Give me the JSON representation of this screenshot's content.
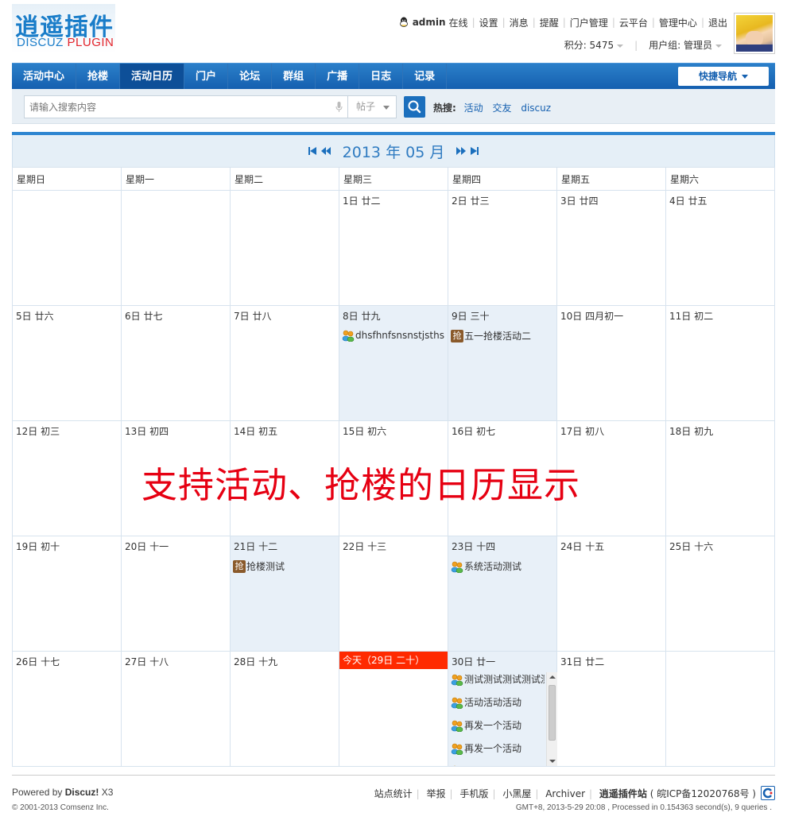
{
  "logo": {
    "cn": "逍遥插件",
    "en_part1": "DISCUZ",
    "en_part2": " PLUGIN"
  },
  "user": {
    "name": "admin",
    "status": "在线",
    "links": [
      "设置",
      "消息",
      "提醒",
      "门户管理",
      "云平台",
      "管理中心",
      "退出"
    ],
    "credits": "积分: 5475",
    "group": "用户组: 管理员"
  },
  "nav": {
    "items": [
      "活动中心",
      "抢楼",
      "活动日历",
      "门户",
      "论坛",
      "群组",
      "广播",
      "日志",
      "记录"
    ],
    "active_index": 2,
    "quick_nav": "快捷导航"
  },
  "search": {
    "placeholder": "请输入搜索内容",
    "type": "帖子",
    "hot_label": "热搜:",
    "hot_terms": [
      "活动",
      "交友",
      "discuz"
    ]
  },
  "calendar": {
    "title": "2013 年 05 月",
    "weekdays": [
      "星期日",
      "星期一",
      "星期二",
      "星期三",
      "星期四",
      "星期五",
      "星期六"
    ],
    "weeks": [
      [
        {
          "label": ""
        },
        {
          "label": ""
        },
        {
          "label": ""
        },
        {
          "label": "1日 廿二"
        },
        {
          "label": "2日 廿三"
        },
        {
          "label": "3日 廿四"
        },
        {
          "label": "4日 廿五"
        }
      ],
      [
        {
          "label": "5日 廿六"
        },
        {
          "label": "6日 廿七"
        },
        {
          "label": "7日 廿八"
        },
        {
          "label": "8日 廿九",
          "events": [
            {
              "icon": "activity",
              "text": "dhsfhnfsnsnstjsthsh"
            }
          ]
        },
        {
          "label": "9日 三十",
          "events": [
            {
              "icon": "qianglou",
              "text": "五一抢楼活动二"
            }
          ]
        },
        {
          "label": "10日 四月初一"
        },
        {
          "label": "11日 初二"
        }
      ],
      [
        {
          "label": "12日 初三"
        },
        {
          "label": "13日 初四"
        },
        {
          "label": "14日 初五"
        },
        {
          "label": "15日 初六"
        },
        {
          "label": "16日 初七"
        },
        {
          "label": "17日 初八"
        },
        {
          "label": "18日 初九"
        }
      ],
      [
        {
          "label": "19日 初十"
        },
        {
          "label": "20日 十一"
        },
        {
          "label": "21日 十二",
          "events": [
            {
              "icon": "qianglou",
              "text": "抢楼测试"
            }
          ]
        },
        {
          "label": "22日 十三"
        },
        {
          "label": "23日 十四",
          "events": [
            {
              "icon": "activity",
              "text": "系统活动测试"
            }
          ]
        },
        {
          "label": "24日 十五"
        },
        {
          "label": "25日 十六"
        }
      ],
      [
        {
          "label": "26日 十七"
        },
        {
          "label": "27日 十八"
        },
        {
          "label": "28日 十九"
        },
        {
          "label": "今天（29日 二十）",
          "today": true
        },
        {
          "label": "30日 廿一",
          "scroll": true,
          "events": [
            {
              "icon": "activity",
              "text": "测试测试测试测试测试"
            },
            {
              "icon": "activity",
              "text": "活动活动活动"
            },
            {
              "icon": "activity",
              "text": "再发一个活动"
            },
            {
              "icon": "activity",
              "text": "再发一个活动"
            },
            {
              "icon": "activity",
              "text": ""
            }
          ]
        },
        {
          "label": "31日 廿二"
        },
        {
          "label": ""
        }
      ]
    ],
    "qianglou_glyph": "抢"
  },
  "overlay_text": "支持活动、抢楼的日历显示",
  "footer": {
    "powered_prefix": "Powered by ",
    "powered_brand": "Discuz!",
    "powered_version": " X3",
    "copyright": "© 2001-2013 Comsenz Inc.",
    "links": [
      "站点统计",
      "举报",
      "手机版",
      "小黑屋",
      "Archiver"
    ],
    "site_name": "逍遥插件站",
    "icp": "( 皖ICP备12020768号 )",
    "info": "GMT+8, 2013-5-29 20:08 , Processed in 0.154363 second(s), 9 queries ."
  },
  "colors": {
    "brand_blue": "#1560b0",
    "today_red": "#ff2a00",
    "event_cell_bg": "#e8f0f8",
    "overlay_red": "#e60012"
  }
}
